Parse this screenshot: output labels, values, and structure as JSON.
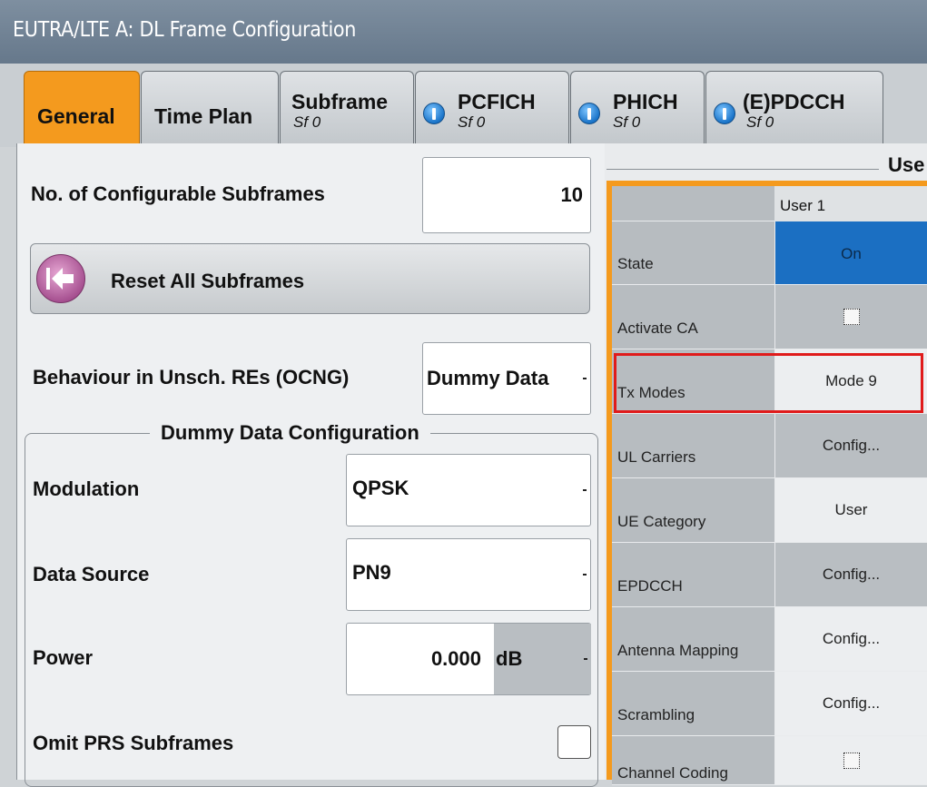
{
  "window": {
    "title": "EUTRA/LTE A: DL Frame Configuration"
  },
  "tabs": [
    {
      "label": "General",
      "sub": "",
      "info": false,
      "active": true
    },
    {
      "label": "Time Plan",
      "sub": "",
      "info": false,
      "active": false
    },
    {
      "label": "Subframe",
      "sub": "Sf 0",
      "info": false,
      "active": false
    },
    {
      "label": "PCFICH",
      "sub": "Sf 0",
      "info": true,
      "active": false
    },
    {
      "label": "PHICH",
      "sub": "Sf 0",
      "info": true,
      "active": false
    },
    {
      "label": "(E)PDCCH",
      "sub": "Sf 0",
      "info": true,
      "active": false
    }
  ],
  "general": {
    "configurable_subframes": {
      "label": "No. of Configurable Subframes",
      "value": "10"
    },
    "reset_button": {
      "label": "Reset All Subframes",
      "icon": "arrow-left-icon"
    },
    "behaviour": {
      "label": "Behaviour in Unsch. REs (OCNG)",
      "value": "Dummy Data"
    },
    "dummy": {
      "title": "Dummy Data Configuration",
      "modulation": {
        "label": "Modulation",
        "value": "QPSK"
      },
      "data_source": {
        "label": "Data Source",
        "value": "PN9"
      },
      "power": {
        "label": "Power",
        "value": "0.000",
        "unit": "dB"
      },
      "omit_prs": {
        "label": "Omit PRS Subframes",
        "checked": false
      }
    }
  },
  "user_config": {
    "title": "Use",
    "column_header": "User 1",
    "rows": [
      {
        "label": "State",
        "value": "On"
      },
      {
        "label": "Activate CA",
        "value": "",
        "checkbox": true
      },
      {
        "label": "Tx Modes",
        "value": "Mode 9",
        "highlighted": true
      },
      {
        "label": "UL Carriers",
        "value": "Config..."
      },
      {
        "label": "UE Category",
        "value": "User"
      },
      {
        "label": "EPDCCH",
        "value": "Config..."
      },
      {
        "label": "Antenna Mapping",
        "value": "Config..."
      },
      {
        "label": "Scrambling",
        "value": "Config..."
      },
      {
        "label": "Channel Coding",
        "value": "",
        "checkbox": true
      }
    ]
  },
  "colors": {
    "accent": "#f49a1e",
    "title_bar": "#6e7f91",
    "state_on": "#1b6fc2",
    "highlight": "#e01b1b"
  }
}
